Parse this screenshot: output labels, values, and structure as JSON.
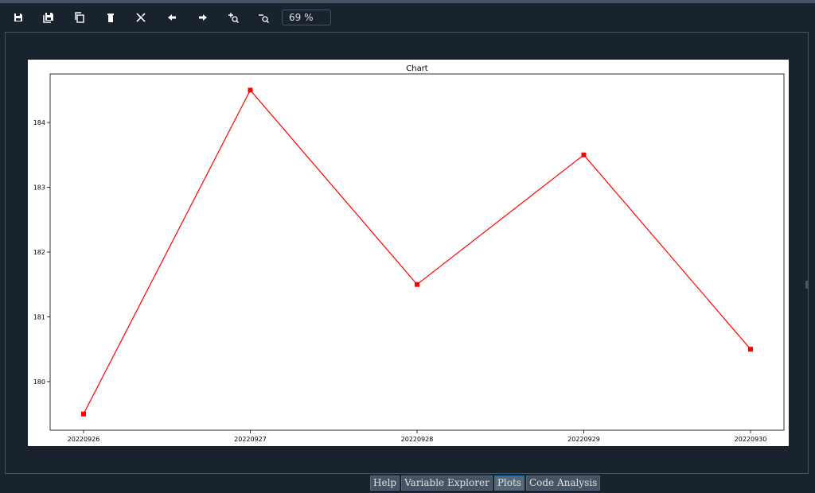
{
  "toolbar": {
    "buttons": [
      {
        "name": "save-icon"
      },
      {
        "name": "save-all-icon"
      },
      {
        "name": "copy-icon"
      },
      {
        "name": "delete-icon"
      },
      {
        "name": "delete-all-icon"
      },
      {
        "name": "arrow-left-icon"
      },
      {
        "name": "arrow-right-icon"
      },
      {
        "name": "zoom-in-icon"
      },
      {
        "name": "zoom-out-icon"
      }
    ],
    "zoom_value": "69 %"
  },
  "bottom_tabs": [
    {
      "label": "Help",
      "active": false
    },
    {
      "label": "Variable Explorer",
      "active": false
    },
    {
      "label": "Plots",
      "active": true
    },
    {
      "label": "Code Analysis",
      "active": false
    }
  ],
  "colors": {
    "background": "#19232d",
    "border": "#455364",
    "line": "#ff0000",
    "active_tab": "#1a72bb"
  },
  "chart_data": {
    "type": "line",
    "title": "Chart",
    "xlabel": "",
    "ylabel": "",
    "categories": [
      "20220926",
      "20220927",
      "20220928",
      "20220929",
      "20220930"
    ],
    "series": [
      {
        "values": [
          179.5,
          184.5,
          181.5,
          183.5,
          180.5
        ],
        "color": "#ff0000",
        "marker": "square"
      }
    ],
    "ylim": [
      179.25,
      184.75
    ],
    "yticks": [
      180,
      181,
      182,
      183,
      184
    ],
    "grid": false,
    "legend": "none"
  }
}
